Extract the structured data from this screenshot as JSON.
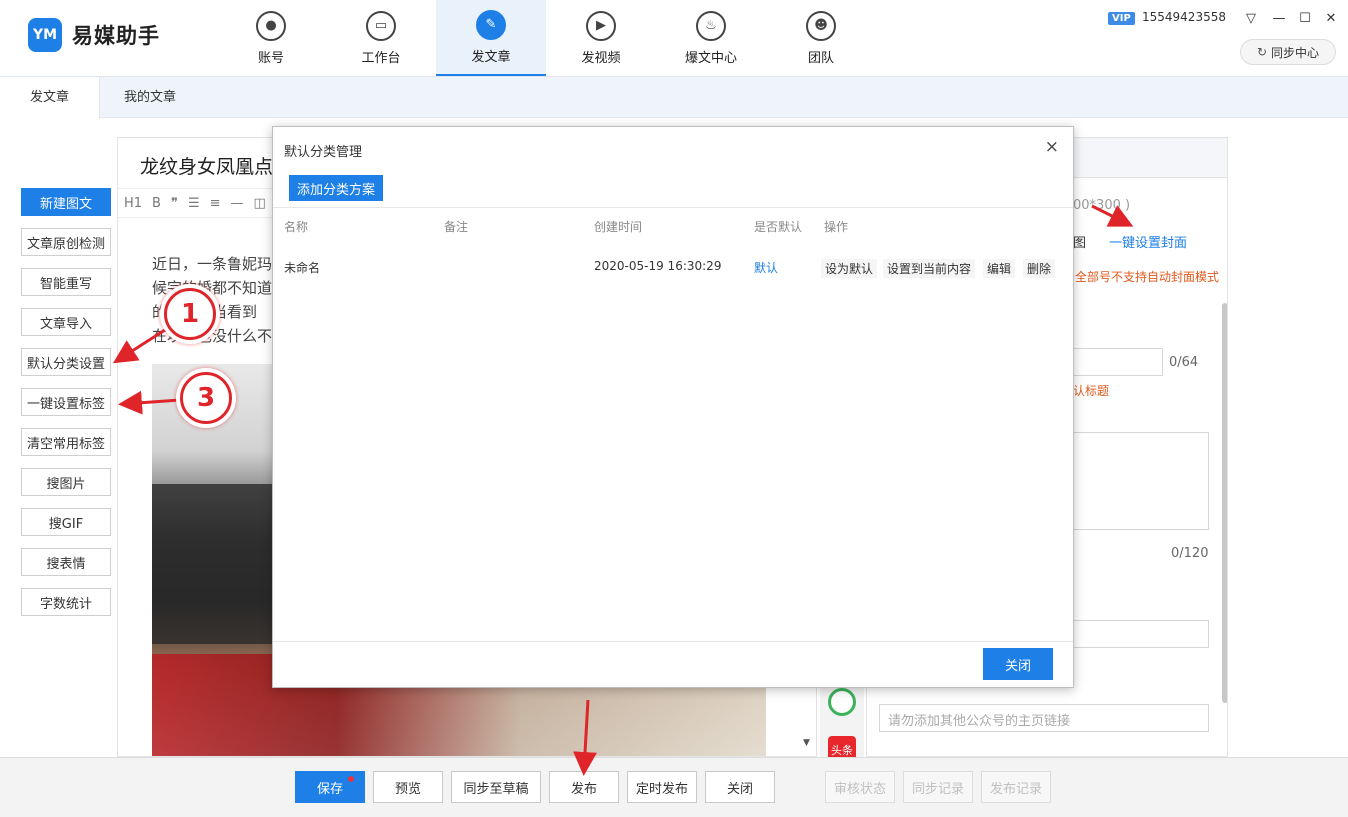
{
  "app": {
    "logo_mark": "YM",
    "name": "易媒助手"
  },
  "nav": [
    {
      "label": "账号",
      "icon": "user-icon",
      "glyph": "●",
      "active": false
    },
    {
      "label": "工作台",
      "icon": "monitor-icon",
      "glyph": "▭",
      "active": false
    },
    {
      "label": "发文章",
      "icon": "feather-icon",
      "glyph": "✎",
      "active": true
    },
    {
      "label": "发视频",
      "icon": "play-icon",
      "glyph": "▶",
      "active": false
    },
    {
      "label": "爆文中心",
      "icon": "flame-icon",
      "glyph": "♨",
      "active": false
    },
    {
      "label": "团队",
      "icon": "team-icon",
      "glyph": "☻",
      "active": false
    }
  ],
  "window": {
    "vip": "VIP",
    "phone": "15549423558",
    "sync_label": "同步中心",
    "sync_glyph": "↻",
    "menu_glyph": "▽",
    "min_glyph": "—",
    "max_glyph": "☐",
    "close_glyph": "✕"
  },
  "tabs": [
    {
      "label": "发文章",
      "active": true
    },
    {
      "label": "我的文章",
      "active": false
    }
  ],
  "sidebar": [
    {
      "label": "新建图文",
      "primary": true
    },
    {
      "label": "文章原创检测"
    },
    {
      "label": "智能重写"
    },
    {
      "label": "文章导入"
    },
    {
      "label": "默认分类设置"
    },
    {
      "label": "一键设置标签"
    },
    {
      "label": "清空常用标签"
    },
    {
      "label": "搜图片"
    },
    {
      "label": "搜GIF"
    },
    {
      "label": "搜表情"
    },
    {
      "label": "字数统计"
    }
  ],
  "editor": {
    "title": "龙纹身女凤凰点",
    "toolbar": [
      "H1",
      "B",
      "❞",
      "☰",
      "≡",
      "—",
      "◫"
    ],
    "body_lines": [
      "近日，一条鲁妮玛",
      "候完的婚都不知道",
      "的，下…当看到",
      "在坟…也没什么不"
    ]
  },
  "right_panel": {
    "size_hint": "00*300 )",
    "cover_tab": "图",
    "cover_link": "一键设置封面",
    "cover_warning": "…全部号不支持自动封面模式",
    "title_count": "0/64",
    "title_hint": "认标题",
    "summary_count": "0/120",
    "homepage_placeholder": "请勿添加其他公众号的主页链接",
    "platform_toutiao": "头条",
    "scroll_down": "▼"
  },
  "bottom": {
    "save": "保存",
    "preview": "预览",
    "sync_draft": "同步至草稿",
    "publish": "发布",
    "schedule": "定时发布",
    "close": "关闭",
    "review_status": "审核状态",
    "sync_record": "同步记录",
    "publish_record": "发布记录"
  },
  "modal": {
    "title": "默认分类管理",
    "close_glyph": "×",
    "add_button": "添加分类方案",
    "columns": {
      "name": "名称",
      "remark": "备注",
      "created": "创建时间",
      "is_default": "是否默认",
      "actions": "操作"
    },
    "rows": [
      {
        "name": "未命名",
        "remark": "",
        "created": "2020-05-19 16:30:29",
        "is_default": "默认",
        "actions": [
          "设为默认",
          "设置到当前内容",
          "编辑",
          "删除"
        ]
      }
    ],
    "ok_button": "关闭"
  },
  "annotations": {
    "badge1": "1",
    "badge3": "3"
  },
  "colors": {
    "accent": "#1e7fe6",
    "annotation_red": "#e0252a",
    "warning_orange": "#e05a1e"
  }
}
